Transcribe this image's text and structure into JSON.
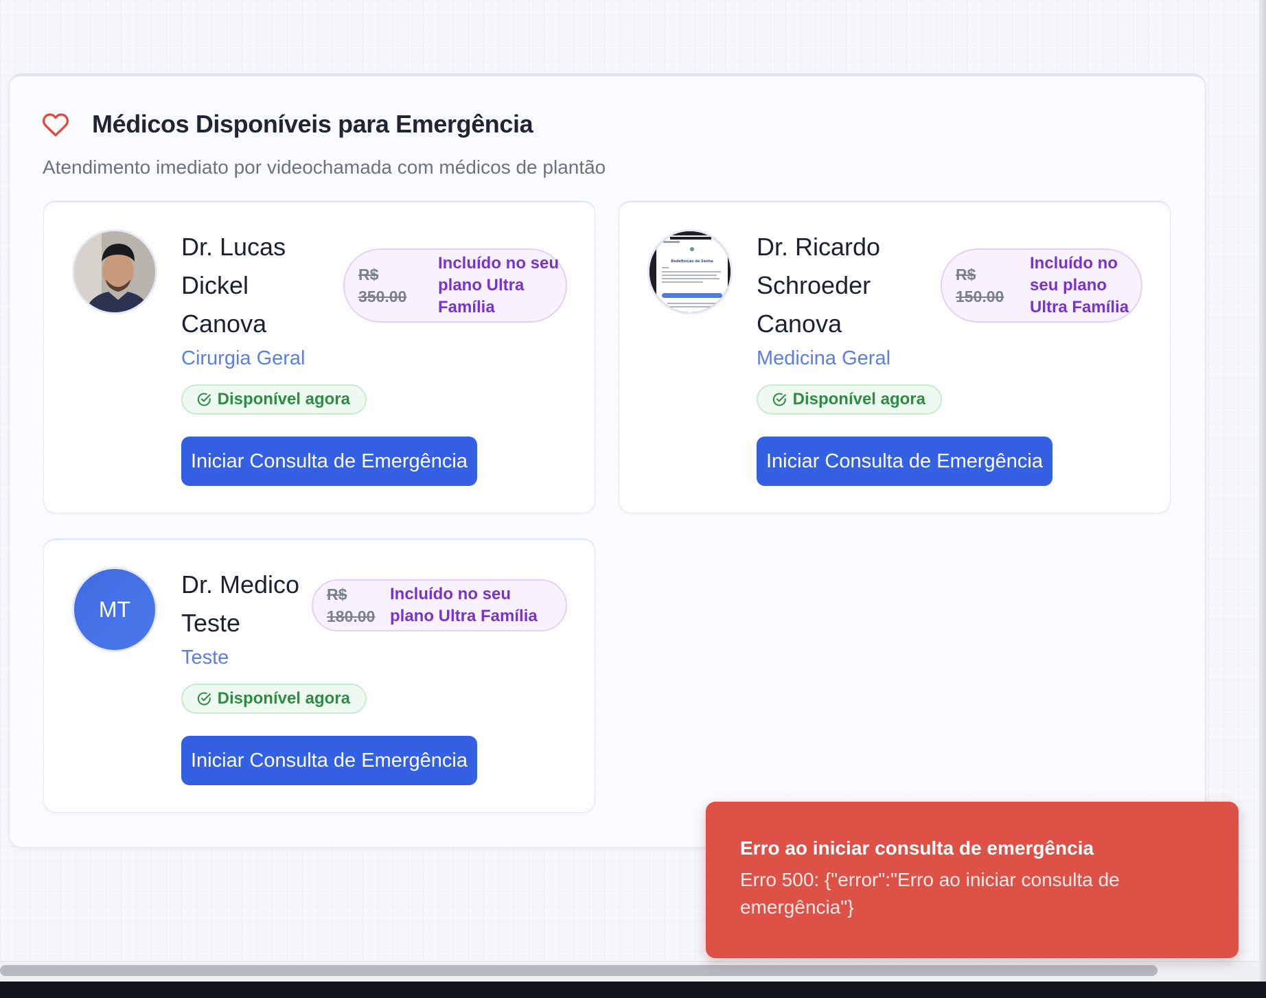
{
  "header": {
    "title": "Médicos Disponíveis para Emergência",
    "subtitle": "Atendimento imediato por videochamada com médicos de plantão",
    "icon": "heart-icon",
    "icon_color": "#e04a3f"
  },
  "doctors": [
    {
      "name_lines": [
        "Dr. Lucas",
        "Dickel",
        "Canova"
      ],
      "specialty": "Cirurgia Geral",
      "avatar": "photo",
      "price_currency": "R$",
      "price_amount": "350.00",
      "plan_lines": [
        "Incluído no seu",
        "plano Ultra",
        "Família"
      ],
      "status": "Disponível agora",
      "cta": "Iniciar Consulta de Emergência"
    },
    {
      "name_lines": [
        "Dr. Ricardo",
        "Schroeder",
        "Canova"
      ],
      "specialty": "Medicina Geral",
      "avatar": "screenshot",
      "avatar_text": "Redefinição de Senha",
      "price_currency": "R$",
      "price_amount": "150.00",
      "plan_lines": [
        "Incluído no",
        "seu plano",
        "Ultra Família"
      ],
      "status": "Disponível agora",
      "cta": "Iniciar Consulta de Emergência"
    },
    {
      "name_lines": [
        "Dr. Medico",
        "Teste"
      ],
      "specialty": "Teste",
      "avatar": "initials",
      "initials": "MT",
      "price_currency": "R$",
      "price_amount": "180.00",
      "plan_lines": [
        "Incluído no seu",
        "plano Ultra Família"
      ],
      "status": "Disponível agora",
      "cta": "Iniciar Consulta de Emergência"
    }
  ],
  "toast": {
    "title": "Erro ao iniciar consulta de emergência",
    "message_lines": [
      "Erro 500: {\"error\":\"Erro ao iniciar consulta de",
      "emergência\"}"
    ]
  },
  "colors": {
    "primary": "#3460e3",
    "success": "#2e8b43",
    "plan": "#7a33c9",
    "error": "#de5147"
  }
}
